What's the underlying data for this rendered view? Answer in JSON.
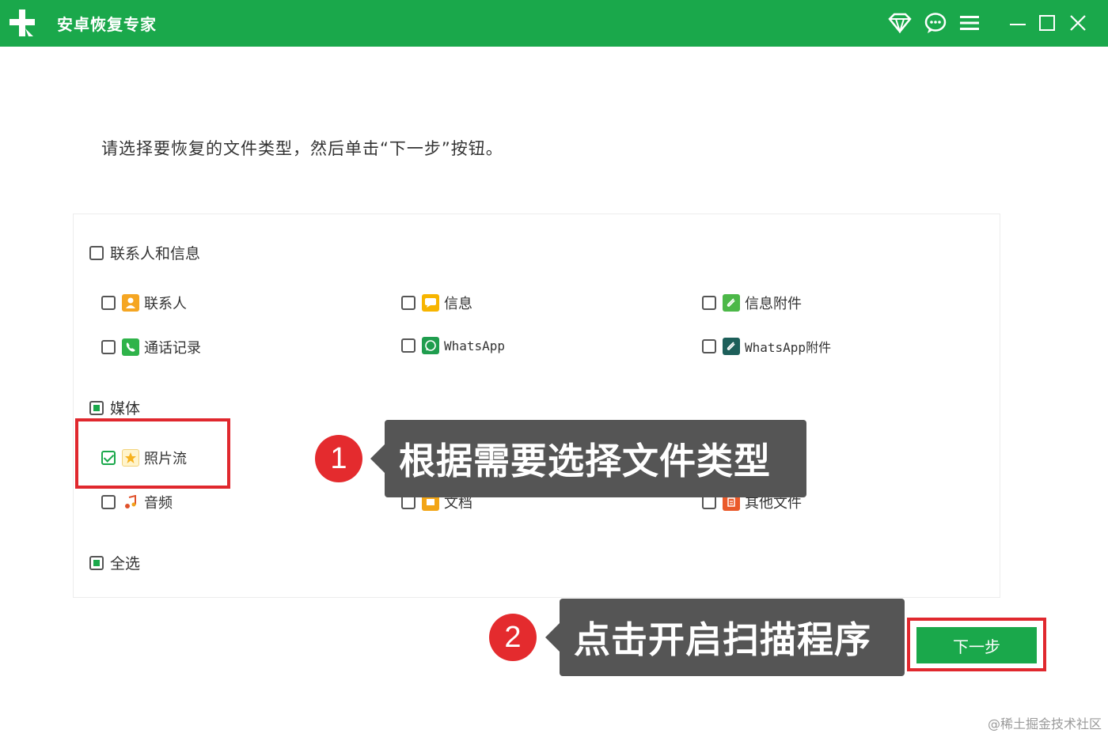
{
  "window": {
    "title": "安卓恢复专家"
  },
  "instruction": "请选择要恢复的文件类型，然后单击“下一步”按钮。",
  "groups": {
    "contacts_messages": {
      "label": "联系人和信息",
      "items": [
        {
          "label": "联系人",
          "icon": "contact-icon",
          "color": "#f5a623"
        },
        {
          "label": "信息",
          "icon": "message-icon",
          "color": "#f7b500"
        },
        {
          "label": "信息附件",
          "icon": "attachment-icon",
          "color": "#4cb848"
        },
        {
          "label": "通话记录",
          "icon": "phone-icon",
          "color": "#2fb34a"
        },
        {
          "label": "WhatsApp",
          "icon": "whatsapp-icon",
          "color": "#1f9d4e"
        },
        {
          "label": "WhatsApp附件",
          "icon": "whatsapp-attachment-icon",
          "color": "#1d5f5a"
        }
      ]
    },
    "media": {
      "label": "媒体",
      "items": [
        {
          "label": "照片流",
          "icon": "photo-star-icon",
          "color": "#f7c21e"
        },
        {
          "label": "音频",
          "icon": "audio-icon",
          "color": "#e0512b"
        },
        {
          "label": "文档",
          "icon": "document-icon",
          "color": "#f2a516"
        },
        {
          "label": "其他文件",
          "icon": "other-file-icon",
          "color": "#ea5a2a"
        }
      ]
    },
    "select_all": {
      "label": "全选"
    }
  },
  "annotations": {
    "step1": {
      "number": "1",
      "text": "根据需要选择文件类型"
    },
    "step2": {
      "number": "2",
      "text": "点击开启扫描程序"
    }
  },
  "next_button": "下一步",
  "watermark": "@稀土掘金技术社区",
  "colors": {
    "brand": "#1aa84b",
    "highlight": "#e0282e",
    "callout": "#555555"
  }
}
